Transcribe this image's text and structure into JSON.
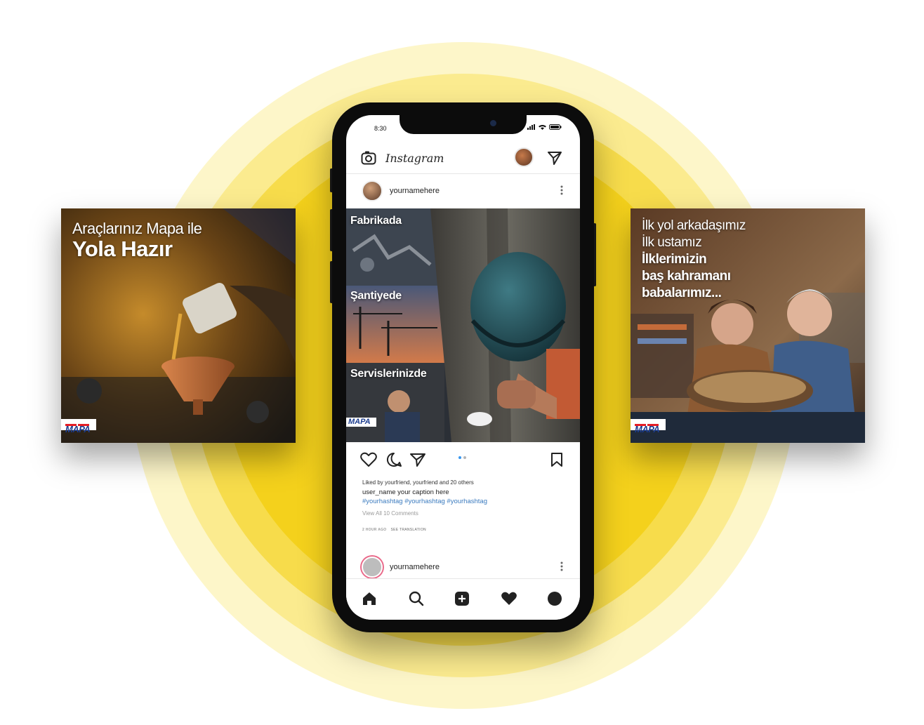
{
  "left_post": {
    "line1": "Araçlarınız Mapa ile",
    "line2": "Yola Hazır",
    "logo": "MAPA"
  },
  "right_post": {
    "line1": "İlk yol arkadaşımız",
    "line2": "İlk ustamız",
    "line3": "İlklerimizin",
    "line4": "baş kahramanı",
    "line5": "babalarımız...",
    "logo": "MAPA"
  },
  "phone": {
    "time": "8:30",
    "app_name": "Instagram",
    "post": {
      "username": "yournamehere",
      "labels": [
        "Fabrikada",
        "Şantiyede",
        "Servislerinizde"
      ],
      "logo": "MAPA",
      "likes_text": "Liked by yourfriend, yourfriend and 20 others",
      "caption": "user_name  your caption here",
      "hashtags": "#yourhashtag #yourhashtag #yourhashtag",
      "view_all": "View All 10 Comments",
      "time_ago": "2 HOUR AGO",
      "see_translation": "SEE TRANSLATION"
    },
    "post2": {
      "username": "yournamehere"
    }
  },
  "icons": {
    "header": [
      "camera-icon",
      "send-icon"
    ],
    "actions": [
      "heart-icon",
      "comment-icon",
      "share-icon",
      "bookmark-icon"
    ],
    "tabs": [
      "home-icon",
      "search-icon",
      "add-icon",
      "heart-icon",
      "profile-icon"
    ]
  },
  "colors": {
    "accent_yellow": "#f4d11c",
    "link_blue": "#3b7bbf",
    "brand_blue": "#1c3d8f"
  }
}
